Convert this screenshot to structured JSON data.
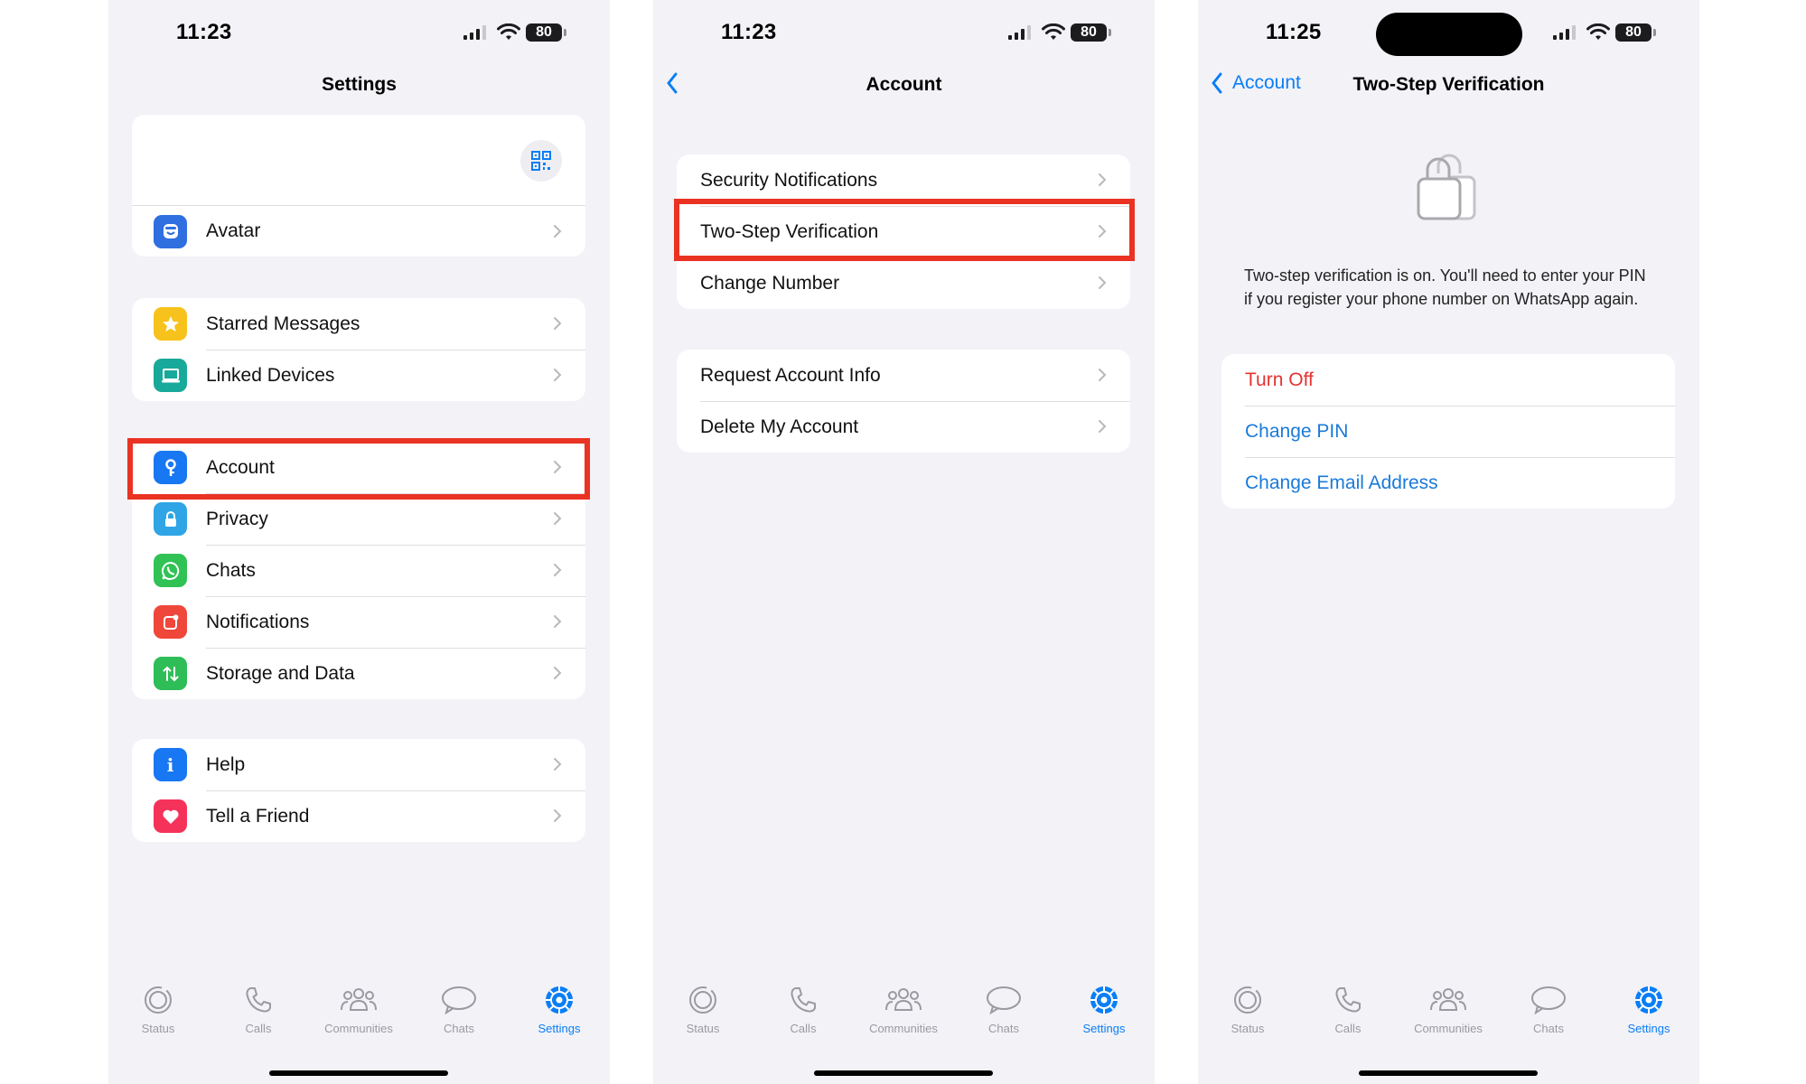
{
  "screens": [
    {
      "time": "11:23",
      "battery": "80",
      "title": "Settings",
      "sections": [
        {
          "items": [
            {
              "label": "Avatar",
              "icon": "avatar-icon",
              "color": "#2f6fe0"
            }
          ]
        },
        {
          "items": [
            {
              "label": "Starred Messages",
              "icon": "star-icon",
              "color": "#f7c21b"
            },
            {
              "label": "Linked Devices",
              "icon": "laptop-icon",
              "color": "#19a99a"
            }
          ]
        },
        {
          "items": [
            {
              "label": "Account",
              "icon": "key-icon",
              "color": "#1877f2",
              "highlighted": true
            },
            {
              "label": "Privacy",
              "icon": "lock-icon",
              "color": "#2fa5e6"
            },
            {
              "label": "Chats",
              "icon": "whatsapp-icon",
              "color": "#30c254"
            },
            {
              "label": "Notifications",
              "icon": "notification-icon",
              "color": "#f0473b"
            },
            {
              "label": "Storage and Data",
              "icon": "arrows-updown-icon",
              "color": "#2fbd57"
            }
          ]
        },
        {
          "items": [
            {
              "label": "Help",
              "icon": "info-icon",
              "color": "#1877f2"
            },
            {
              "label": "Tell a Friend",
              "icon": "heart-icon",
              "color": "#f5335a"
            }
          ]
        }
      ]
    },
    {
      "time": "11:23",
      "battery": "80",
      "title": "Account",
      "sections": [
        {
          "items": [
            {
              "label": "Security Notifications"
            },
            {
              "label": "Two-Step Verification",
              "highlighted": true
            },
            {
              "label": "Change Number"
            }
          ]
        },
        {
          "items": [
            {
              "label": "Request Account Info"
            },
            {
              "label": "Delete My Account"
            }
          ]
        }
      ]
    },
    {
      "time": "11:25",
      "battery": "80",
      "title": "Two-Step Verification",
      "back_label": "Account",
      "description": "Two-step verification is on. You'll need to enter your PIN if you register your phone number on WhatsApp again.",
      "actions": [
        {
          "label": "Turn Off",
          "color": "#e3342f"
        },
        {
          "label": "Change PIN",
          "color": "#1a7ad9"
        },
        {
          "label": "Change Email Address",
          "color": "#1a7ad9"
        }
      ]
    }
  ],
  "tabbar": [
    {
      "label": "Status",
      "icon": "status-icon"
    },
    {
      "label": "Calls",
      "icon": "phone-icon"
    },
    {
      "label": "Communities",
      "icon": "communities-icon"
    },
    {
      "label": "Chats",
      "icon": "chat-bubble-icon"
    },
    {
      "label": "Settings",
      "icon": "settings-gear-icon",
      "active": true
    }
  ],
  "colors": {
    "accent": "#0a7ef5",
    "highlight": "#ea3323",
    "background": "#f2f2f7"
  }
}
